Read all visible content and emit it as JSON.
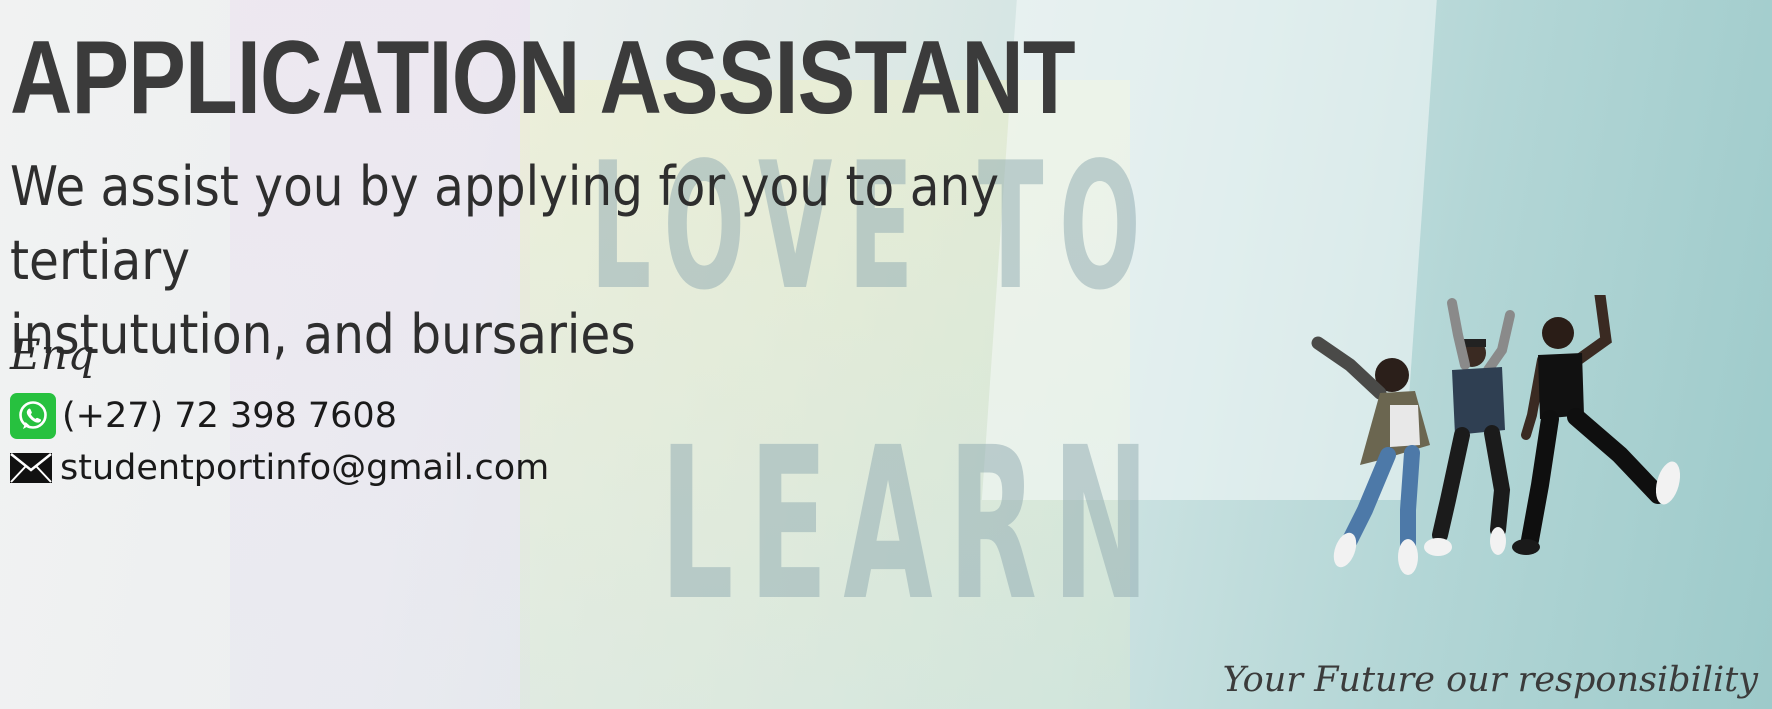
{
  "banner": {
    "title": "APPLICATION ASSISTANT",
    "tagline_line1": "We assist you by applying for you to any tertiary",
    "tagline_line2": "instutution, and bursaries",
    "background_text_line1": "LOVE TO",
    "background_text_line2": "LEARN"
  },
  "contact": {
    "enq_label": "Enq",
    "phone": "(+27) 72 398 7608",
    "phone_icon": "whatsapp-icon",
    "email": "studentportinfo@gmail.com",
    "email_icon": "envelope-icon"
  },
  "slogan": "Your Future our responsibility",
  "colors": {
    "title": "#3b3b3b",
    "whatsapp_green": "#27c13f",
    "background_teal": "#9dcaca"
  }
}
